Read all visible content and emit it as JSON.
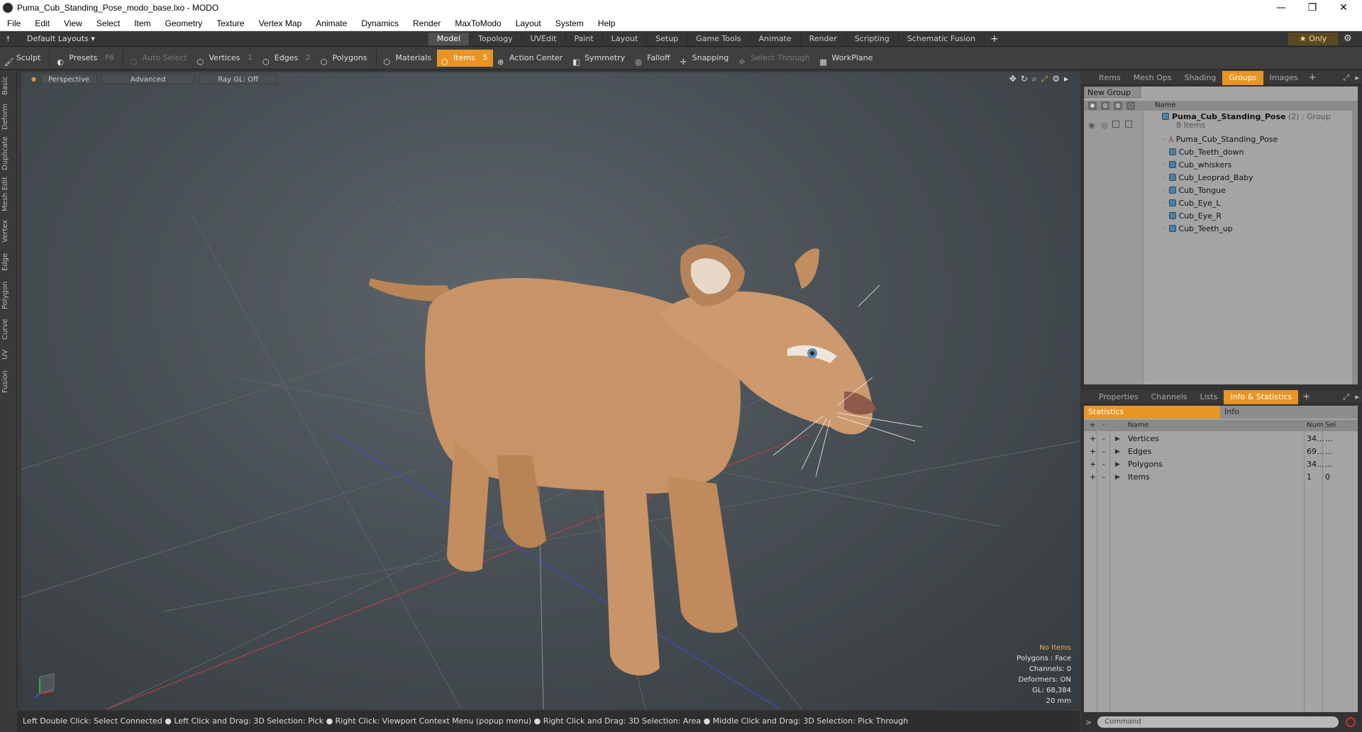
{
  "window": {
    "title": "Puma_Cub_Standing_Pose_modo_base.lxo - MODO"
  },
  "menu": [
    "File",
    "Edit",
    "View",
    "Select",
    "Item",
    "Geometry",
    "Texture",
    "Vertex Map",
    "Animate",
    "Dynamics",
    "Render",
    "MaxToModo",
    "Layout",
    "System",
    "Help"
  ],
  "layout": {
    "preset": "Default Layouts ▾",
    "tabs": [
      "Model",
      "Topology",
      "UVEdit",
      "Paint",
      "Layout",
      "Setup",
      "Game Tools",
      "Animate",
      "Render",
      "Scripting",
      "Schematic Fusion"
    ],
    "active_tab": "Model",
    "plus": "+",
    "only": "★  Only"
  },
  "toolbar": {
    "sculpt": "Sculpt",
    "presets": "Presets",
    "presets_key": "F6",
    "auto_select": "Auto Select",
    "vertices": "Vertices",
    "vertices_count": "1",
    "edges": "Edges",
    "edges_count": "2",
    "polygons": "Polygons",
    "materials": "Materials",
    "items": "Items",
    "items_count": "5",
    "action_center": "Action Center",
    "symmetry": "Symmetry",
    "falloff": "Falloff",
    "snapping": "Snapping",
    "select_through": "Select Through",
    "workplane": "WorkPlane"
  },
  "left_tabs": [
    "Basic",
    "Deform",
    "Duplicate",
    "Mesh Edit",
    "Vertex",
    "Edge",
    "Polygon",
    "Curve",
    "UV",
    "Fusion"
  ],
  "viewport": {
    "perspective": "Perspective",
    "advanced": "Advanced",
    "raygl": "Ray GL: Off",
    "stats": {
      "no_items": "No Items",
      "polygons": "Polygons : Face",
      "channels": "Channels: 0",
      "deformers": "Deformers: ON",
      "gl": "GL: 68,384",
      "scale": "20 mm"
    }
  },
  "statusbar": "Left Double Click: Select Connected ● Left Click and Drag: 3D Selection: Pick ● Right Click: Viewport Context Menu (popup menu) ● Right Click and Drag: 3D Selection: Area ● Middle Click and Drag: 3D Selection: Pick Through",
  "upper_panel": {
    "tabs": [
      "Items",
      "Mesh Ops",
      "Shading",
      "Groups",
      "Images"
    ],
    "active": "Groups",
    "new_group": "New Group",
    "name_header": "Name",
    "group": {
      "name": "Puma_Cub_Standing_Pose",
      "count": "(2)",
      "type": ": Group",
      "items": "8 Items"
    },
    "children": [
      "Puma_Cub_Standing_Pose",
      "Cub_Teeth_down",
      "Cub_whiskers",
      "Cub_Leoprad_Baby",
      "Cub_Tongue",
      "Cub_Eye_L",
      "Cub_Eye_R",
      "Cub_Teeth_up"
    ]
  },
  "lower_panel": {
    "tabs": [
      "Properties",
      "Channels",
      "Lists",
      "Info & Statistics"
    ],
    "active": "Info & Statistics",
    "subtabs": [
      "Statistics",
      "Info"
    ],
    "headers": {
      "name": "Name",
      "num": "Num",
      "sel": "Sel"
    },
    "rows": [
      {
        "name": "Vertices",
        "num": "34...",
        "sel": "..."
      },
      {
        "name": "Edges",
        "num": "69...",
        "sel": "..."
      },
      {
        "name": "Polygons",
        "num": "34...",
        "sel": "..."
      },
      {
        "name": "Items",
        "num": "1",
        "sel": "0"
      }
    ]
  },
  "command": {
    "placeholder": "Command"
  }
}
